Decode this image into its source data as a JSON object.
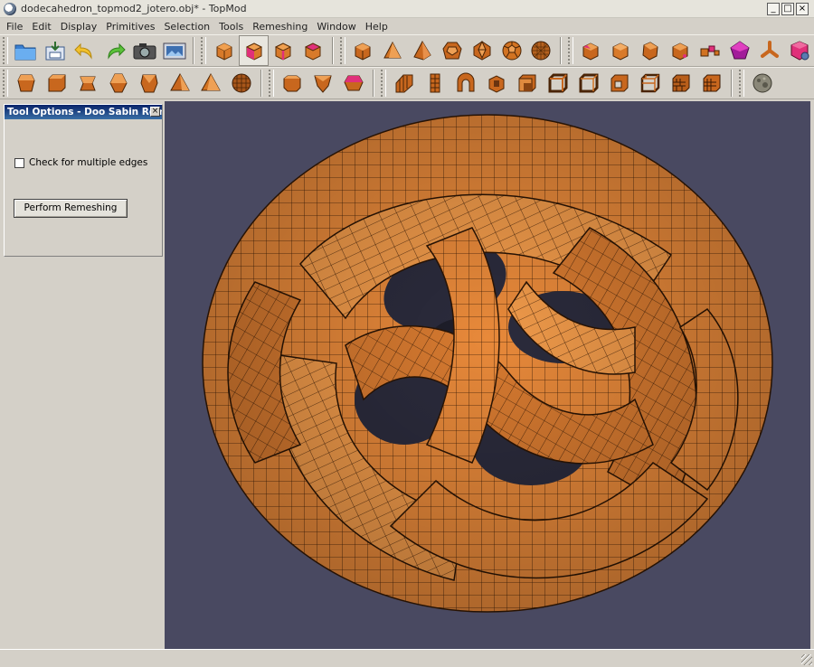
{
  "window": {
    "title": "dodecahedron_topmod2_jotero.obj* - TopMod",
    "minimize": "_",
    "maximize": "□",
    "close": "×"
  },
  "menu": [
    "File",
    "Edit",
    "Display",
    "Primitives",
    "Selection",
    "Tools",
    "Remeshing",
    "Window",
    "Help"
  ],
  "toolbar1": {
    "file_tools": [
      "open-folder-icon",
      "save-icon",
      "undo-icon",
      "redo-icon",
      "camera-icon",
      "screenshot-icon"
    ],
    "mode_tools": [
      "select-vertex-icon",
      "select-face-icon",
      "select-edge-icon",
      "select-corner-icon"
    ],
    "primitives": [
      "cube-icon",
      "tetrahedron-icon",
      "pyramid-icon",
      "dodecahedron-icon",
      "icosahedron-icon",
      "soccer-ball-icon",
      "geodesic-sphere-icon"
    ],
    "remesh_tools": [
      "cut-vertex-icon",
      "cut-face-icon",
      "cut-edge-icon",
      "subdivide-icon",
      "extrude-icon",
      "pentagon-icon",
      "star-icon",
      "settings-cube-icon"
    ]
  },
  "toolbar2": {
    "group_a": [
      "doo-sabin-icon",
      "catmull-clark-icon",
      "honeycomb-icon",
      "root3-icon",
      "loop-icon",
      "pyramid-remesh-icon",
      "star-remesh-icon",
      "sphere-remesh-icon"
    ],
    "group_b": [
      "chamfer-icon",
      "truncate-icon",
      "dual-icon"
    ],
    "group_c": [
      "column-icon",
      "fractal-icon",
      "spiral-icon",
      "rind-icon",
      "corner-cut-icon",
      "wireframe-icon",
      "wireframe-2-icon",
      "frame-icon",
      "lattice-icon",
      "brick-icon",
      "grid-icon"
    ],
    "group_d": [
      "sculpt-icon"
    ]
  },
  "tool_options": {
    "title": "Tool Options - Doo Sabin Rem...",
    "close": "×",
    "checkbox_label": "Check for multiple edges",
    "checkbox_checked": false,
    "button_label": "Perform Remeshing"
  },
  "colors": {
    "viewport_bg": "#494961",
    "mesh_orange": "#e8893a",
    "select_magenta": "#e0307a"
  }
}
